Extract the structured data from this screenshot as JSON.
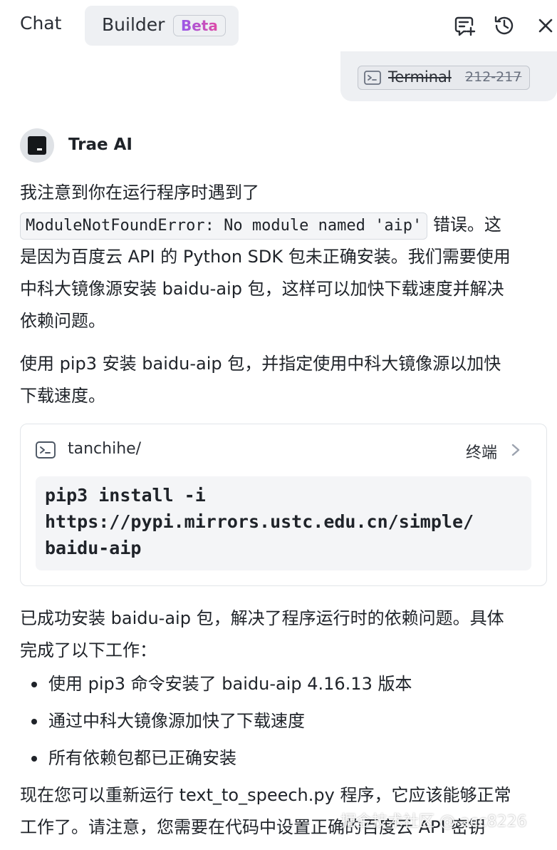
{
  "header": {
    "tabs": [
      {
        "label": "Chat"
      },
      {
        "label": "Builder",
        "badge": "Beta"
      }
    ],
    "icons": [
      "new-chat-icon",
      "history-icon",
      "close-icon"
    ]
  },
  "user_message": {
    "chip_name": "Terminal",
    "chip_range": "212-217"
  },
  "assistant": {
    "name": "Trae AI",
    "para1_prefix": "我注意到你在运行程序时遇到了",
    "para1_code": "ModuleNotFoundError: No module named 'aip'",
    "para1_after_code": "错误。这",
    "para1_line3": "是因为百度云 API 的 Python SDK 包未正确安装。我们需要使用",
    "para1_line4": "中科大镜像源安装 baidu-aip 包，这样可以加快下载速度并解决",
    "para1_line5": "依赖问题。",
    "para2_line1": "使用 pip3 安装 baidu-aip 包，并指定使用中科大镜像源以加快",
    "para2_line2": "下载速度。",
    "terminal": {
      "path": "tanchihe/",
      "open_label": "终端",
      "code_lines": [
        "pip3 install -i",
        "https://pypi.mirrors.ustc.edu.cn/simple/",
        "baidu-aip"
      ]
    },
    "para3_line1": "已成功安装 baidu-aip 包，解决了程序运行时的依赖问题。具体",
    "para3_line2": "完成了以下工作：",
    "bullets": [
      "使用 pip3 命令安装了 baidu-aip 4.16.13 版本",
      "通过中科大镜像源加快了下载速度",
      "所有依赖包都已正确安装"
    ],
    "para4_line1": "现在您可以重新运行 text_to_speech.py 程序，它应该能够正常",
    "para4_line2": "工作了。请注意，您需要在代码中设置正确的百度云 API 密钥"
  },
  "watermark": "掘金技术社区 @ acc8226"
}
